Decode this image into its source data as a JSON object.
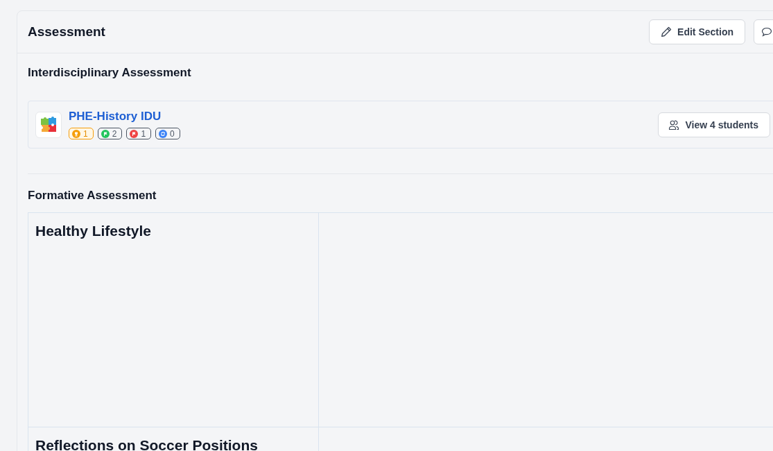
{
  "section": {
    "title": "Assessment",
    "buttons": [
      {
        "kind": "edit",
        "label": "Edit Section"
      },
      {
        "kind": "comment"
      }
    ]
  },
  "interdisciplinary": {
    "heading": "Interdisciplinary Assessment",
    "units": [
      {
        "title": "PHE-History IDU",
        "badges": [
          {
            "kind": "trophy",
            "count": "1",
            "color": "#f59e0b",
            "highlighted": true
          },
          {
            "kind": "flag",
            "count": "2",
            "color": "#22c55e",
            "highlighted": false
          },
          {
            "kind": "flag",
            "count": "1",
            "color": "#ef4444",
            "highlighted": false
          },
          {
            "kind": "refresh",
            "count": "0",
            "color": "#3b82f6",
            "highlighted": false
          }
        ],
        "button": "View 4 students"
      }
    ]
  },
  "formative": {
    "heading": "Formative Assessment",
    "rows": [
      {
        "title": "Healthy Lifestyle"
      },
      {
        "title": "Reflections on Soccer Positions"
      }
    ]
  }
}
